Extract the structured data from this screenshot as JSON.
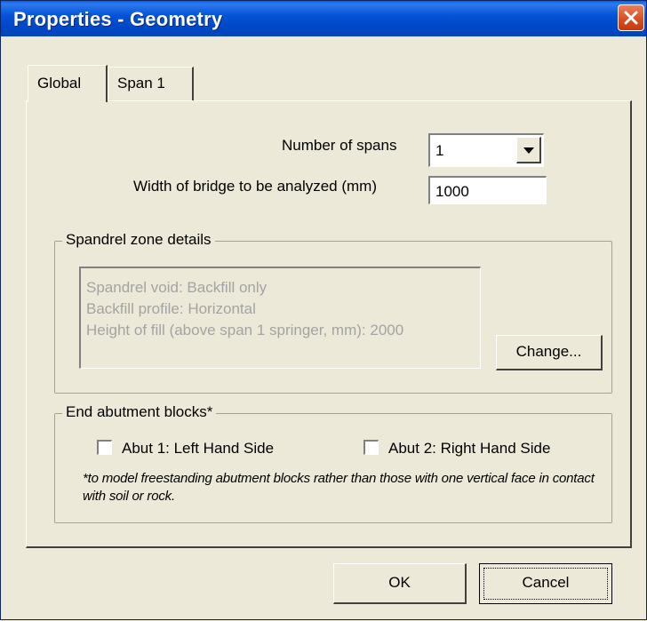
{
  "window": {
    "title": "Properties - Geometry"
  },
  "tabs": [
    {
      "label": "Global",
      "active": true
    },
    {
      "label": "Span 1",
      "active": false
    }
  ],
  "global": {
    "spans_label": "Number of spans",
    "spans_value": "1",
    "width_label": "Width of bridge to be analyzed (mm)",
    "width_value": "1000"
  },
  "spandrel": {
    "legend": "Spandrel zone details",
    "lines": [
      "Spandrel void: Backfill only",
      "Backfill profile: Horizontal",
      "Height of fill (above span 1 springer, mm): 2000"
    ],
    "change_label": "Change..."
  },
  "abutment": {
    "legend": "End abutment blocks*",
    "left_label": "Abut 1: Left Hand Side",
    "left_checked": false,
    "right_label": "Abut 2: Right Hand Side",
    "right_checked": false,
    "note": "*to model freestanding abutment blocks rather than those with one vertical face in contact with soil or rock."
  },
  "buttons": {
    "ok": "OK",
    "cancel": "Cancel"
  },
  "colors": {
    "dialog_bg": "#ECE9D8",
    "titlebar": "#0553D8",
    "close": "#D84B1E",
    "disabled_text": "#A3A3A3"
  },
  "icons": {
    "close": "close-icon",
    "dropdown": "chevron-down-icon"
  }
}
